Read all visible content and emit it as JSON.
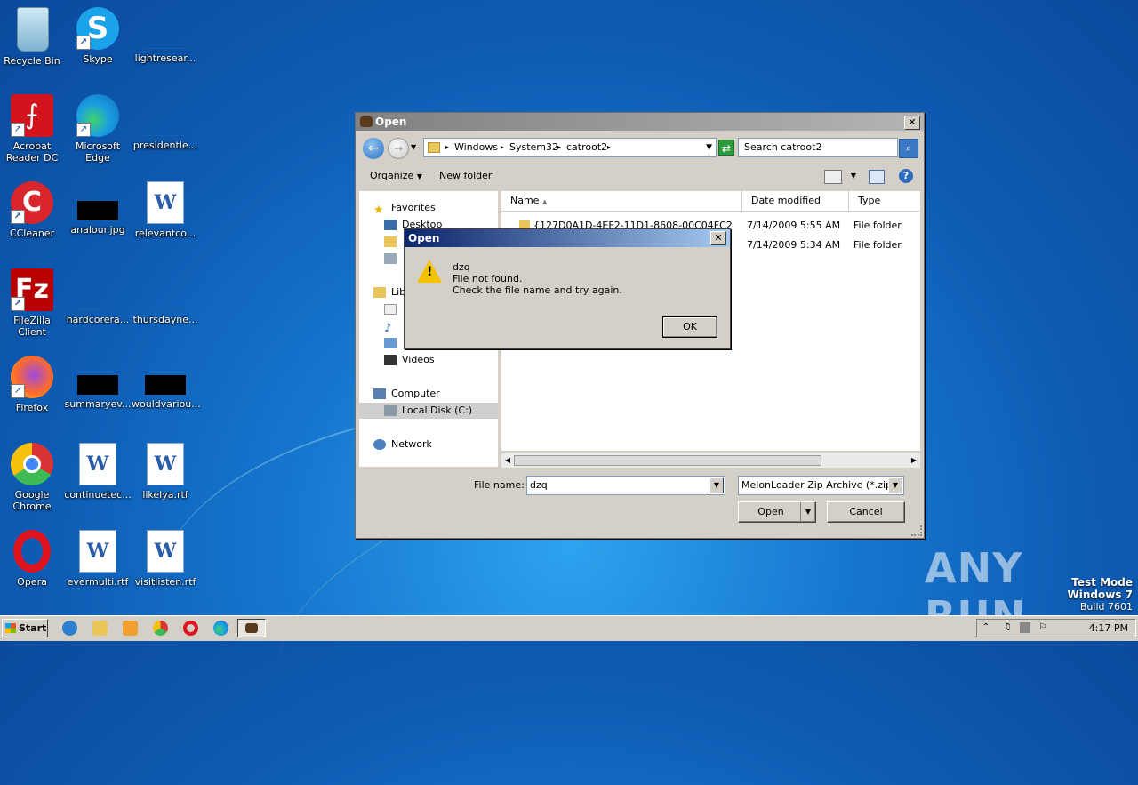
{
  "desktop": {
    "icons": [
      {
        "label": "Recycle Bin"
      },
      {
        "label": "Skype"
      },
      {
        "label": "lightresear..."
      },
      {
        "label": "Acrobat Reader DC"
      },
      {
        "label": "Microsoft Edge"
      },
      {
        "label": "presidentle..."
      },
      {
        "label": "CCleaner"
      },
      {
        "label": "analour.jpg"
      },
      {
        "label": "relevantco..."
      },
      {
        "label": "FileZilla Client"
      },
      {
        "label": "hardcorera..."
      },
      {
        "label": "thursdayne..."
      },
      {
        "label": "Firefox"
      },
      {
        "label": "summaryev..."
      },
      {
        "label": "wouldvariou..."
      },
      {
        "label": "Google Chrome"
      },
      {
        "label": "continuetec..."
      },
      {
        "label": "likelya.rtf"
      },
      {
        "label": "Opera"
      },
      {
        "label": "evermulti.rtf"
      },
      {
        "label": "visitlisten.rtf"
      }
    ]
  },
  "open_dialog": {
    "title": "Open",
    "breadcrumb": [
      "Windows",
      "System32",
      "catroot2"
    ],
    "search_placeholder": "Search catroot2",
    "toolbar": {
      "organize": "Organize",
      "new_folder": "New folder"
    },
    "nav": {
      "favorites": "Favorites",
      "desktop": "Desktop",
      "libraries": "Lib",
      "videos": "Videos",
      "computer": "Computer",
      "local_disk": "Local Disk (C:)",
      "network": "Network"
    },
    "columns": {
      "name": "Name",
      "date_modified": "Date modified",
      "type": "Type"
    },
    "rows": [
      {
        "name": "{127D0A1D-4EF2-11D1-8608-00C04FC295EE}",
        "date": "7/14/2009 5:55 AM",
        "type": "File folder"
      },
      {
        "name": "",
        "date": "7/14/2009 5:34 AM",
        "type": "File folder"
      }
    ],
    "file_name_label": "File name:",
    "file_name_value": "dzq",
    "filter": "MelonLoader Zip Archive (*.zip)",
    "open_button": "Open",
    "cancel_button": "Cancel"
  },
  "message_box": {
    "title": "Open",
    "line1": "dzq",
    "line2": "File not found.",
    "line3": "Check the file name and try again.",
    "ok_button": "OK"
  },
  "taskbar": {
    "start": "Start",
    "clock": "4:17 PM"
  },
  "watermark": "ANY RUN",
  "test_mode": {
    "line1": "Test Mode",
    "line2": "Windows 7",
    "line3": "Build 7601"
  }
}
